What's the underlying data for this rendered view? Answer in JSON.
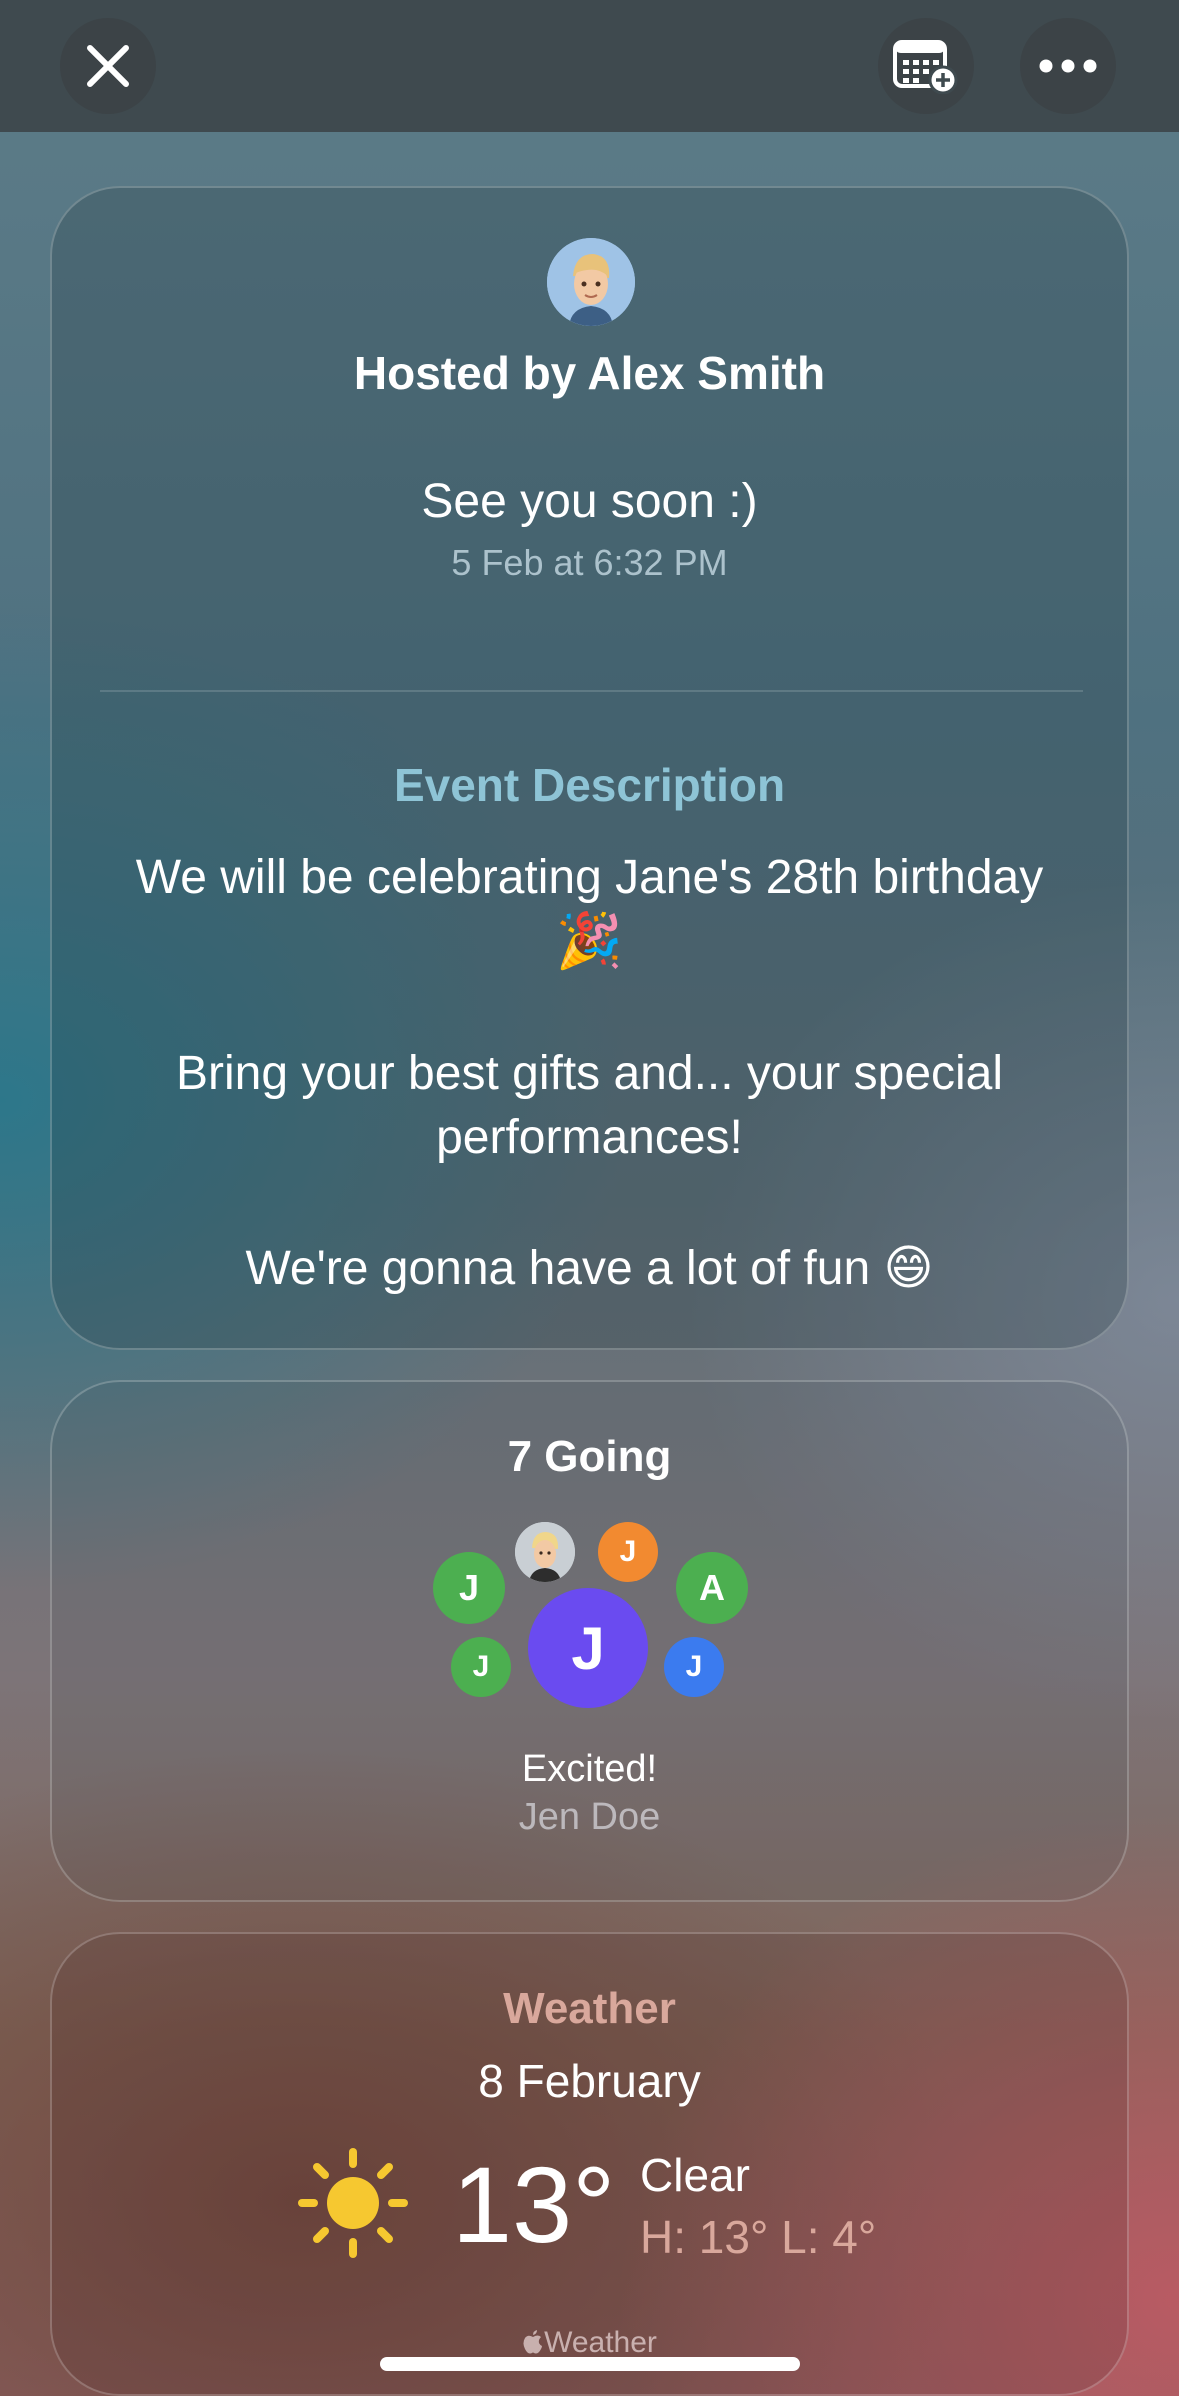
{
  "header": {
    "close_icon": "close-icon",
    "calendar_icon": "calendar-add-icon",
    "more_icon": "more-icon"
  },
  "event_card": {
    "host": "Hosted by Alex Smith",
    "message": "See you soon :)",
    "timestamp": "5 Feb at 6:32 PM",
    "description_title": "Event Description",
    "description_line1": "We will be celebrating Jane's 28th birthday",
    "description_emoji1": "🎉",
    "description_line2": "Bring your best gifts and... your special",
    "description_line3": "performances!",
    "description_line4": "We're gonna have a lot of fun 😄"
  },
  "going_card": {
    "title": "7 Going",
    "attendees": [
      {
        "initial": "J",
        "color": "#4caf50"
      },
      {
        "initial": "J",
        "color": "#f28a30"
      },
      {
        "initial": "A",
        "color": "#4caf50"
      },
      {
        "initial": "J",
        "color": "#4caf50"
      },
      {
        "initial": "J",
        "color": "#6a4bf0"
      },
      {
        "initial": "J",
        "color": "#3b7bef"
      }
    ],
    "status": "Excited!",
    "name": "Jen Doe"
  },
  "weather_card": {
    "title": "Weather",
    "date": "8 February",
    "temperature": "13°",
    "condition": "Clear",
    "high_low": "H: 13° L: 4°",
    "attribution": "Weather",
    "sun_icon": "sun-icon",
    "apple_icon": "apple-icon"
  }
}
